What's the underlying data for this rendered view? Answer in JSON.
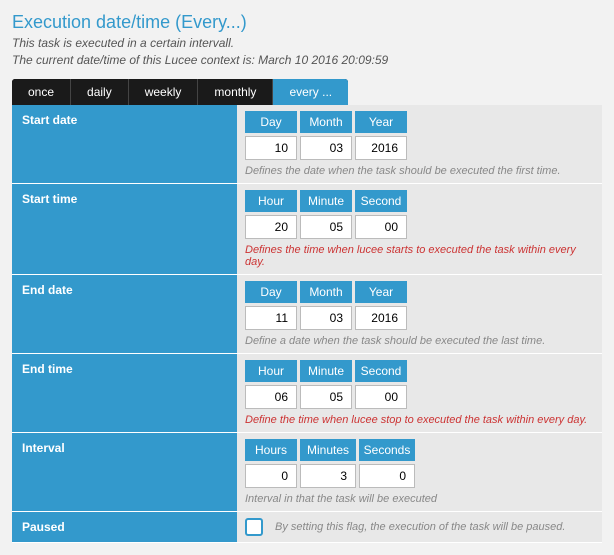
{
  "title": "Execution date/time (Every...)",
  "sub1": "This task is executed in a certain intervall.",
  "sub2": "The current date/time of this Lucee context is:  March 10 2016 20:09:59",
  "tabs": {
    "once": "once",
    "daily": "daily",
    "weekly": "weekly",
    "monthly": "monthly",
    "every": "every ..."
  },
  "rows": {
    "start_date": {
      "label": "Start date",
      "h1": "Day",
      "h2": "Month",
      "h3": "Year",
      "v1": "10",
      "v2": "03",
      "v3": "2016",
      "hint": "Defines the date when the task should be executed the first time."
    },
    "start_time": {
      "label": "Start time",
      "h1": "Hour",
      "h2": "Minute",
      "h3": "Second",
      "v1": "20",
      "v2": "05",
      "v3": "00",
      "hint": "Defines the time when lucee starts to executed the task within every day."
    },
    "end_date": {
      "label": "End date",
      "h1": "Day",
      "h2": "Month",
      "h3": "Year",
      "v1": "11",
      "v2": "03",
      "v3": "2016",
      "hint": "Define a date when the task should be executed the last time."
    },
    "end_time": {
      "label": "End time",
      "h1": "Hour",
      "h2": "Minute",
      "h3": "Second",
      "v1": "06",
      "v2": "05",
      "v3": "00",
      "hint": "Define the time when lucee stop to executed the task within every day."
    },
    "interval": {
      "label": "Interval",
      "h1": "Hours",
      "h2": "Minutes",
      "h3": "Seconds",
      "v1": "0",
      "v2": "3",
      "v3": "0",
      "hint": "Interval in that the task will be executed"
    },
    "paused": {
      "label": "Paused",
      "hint": "By setting this flag, the execution of the task will be paused."
    }
  }
}
